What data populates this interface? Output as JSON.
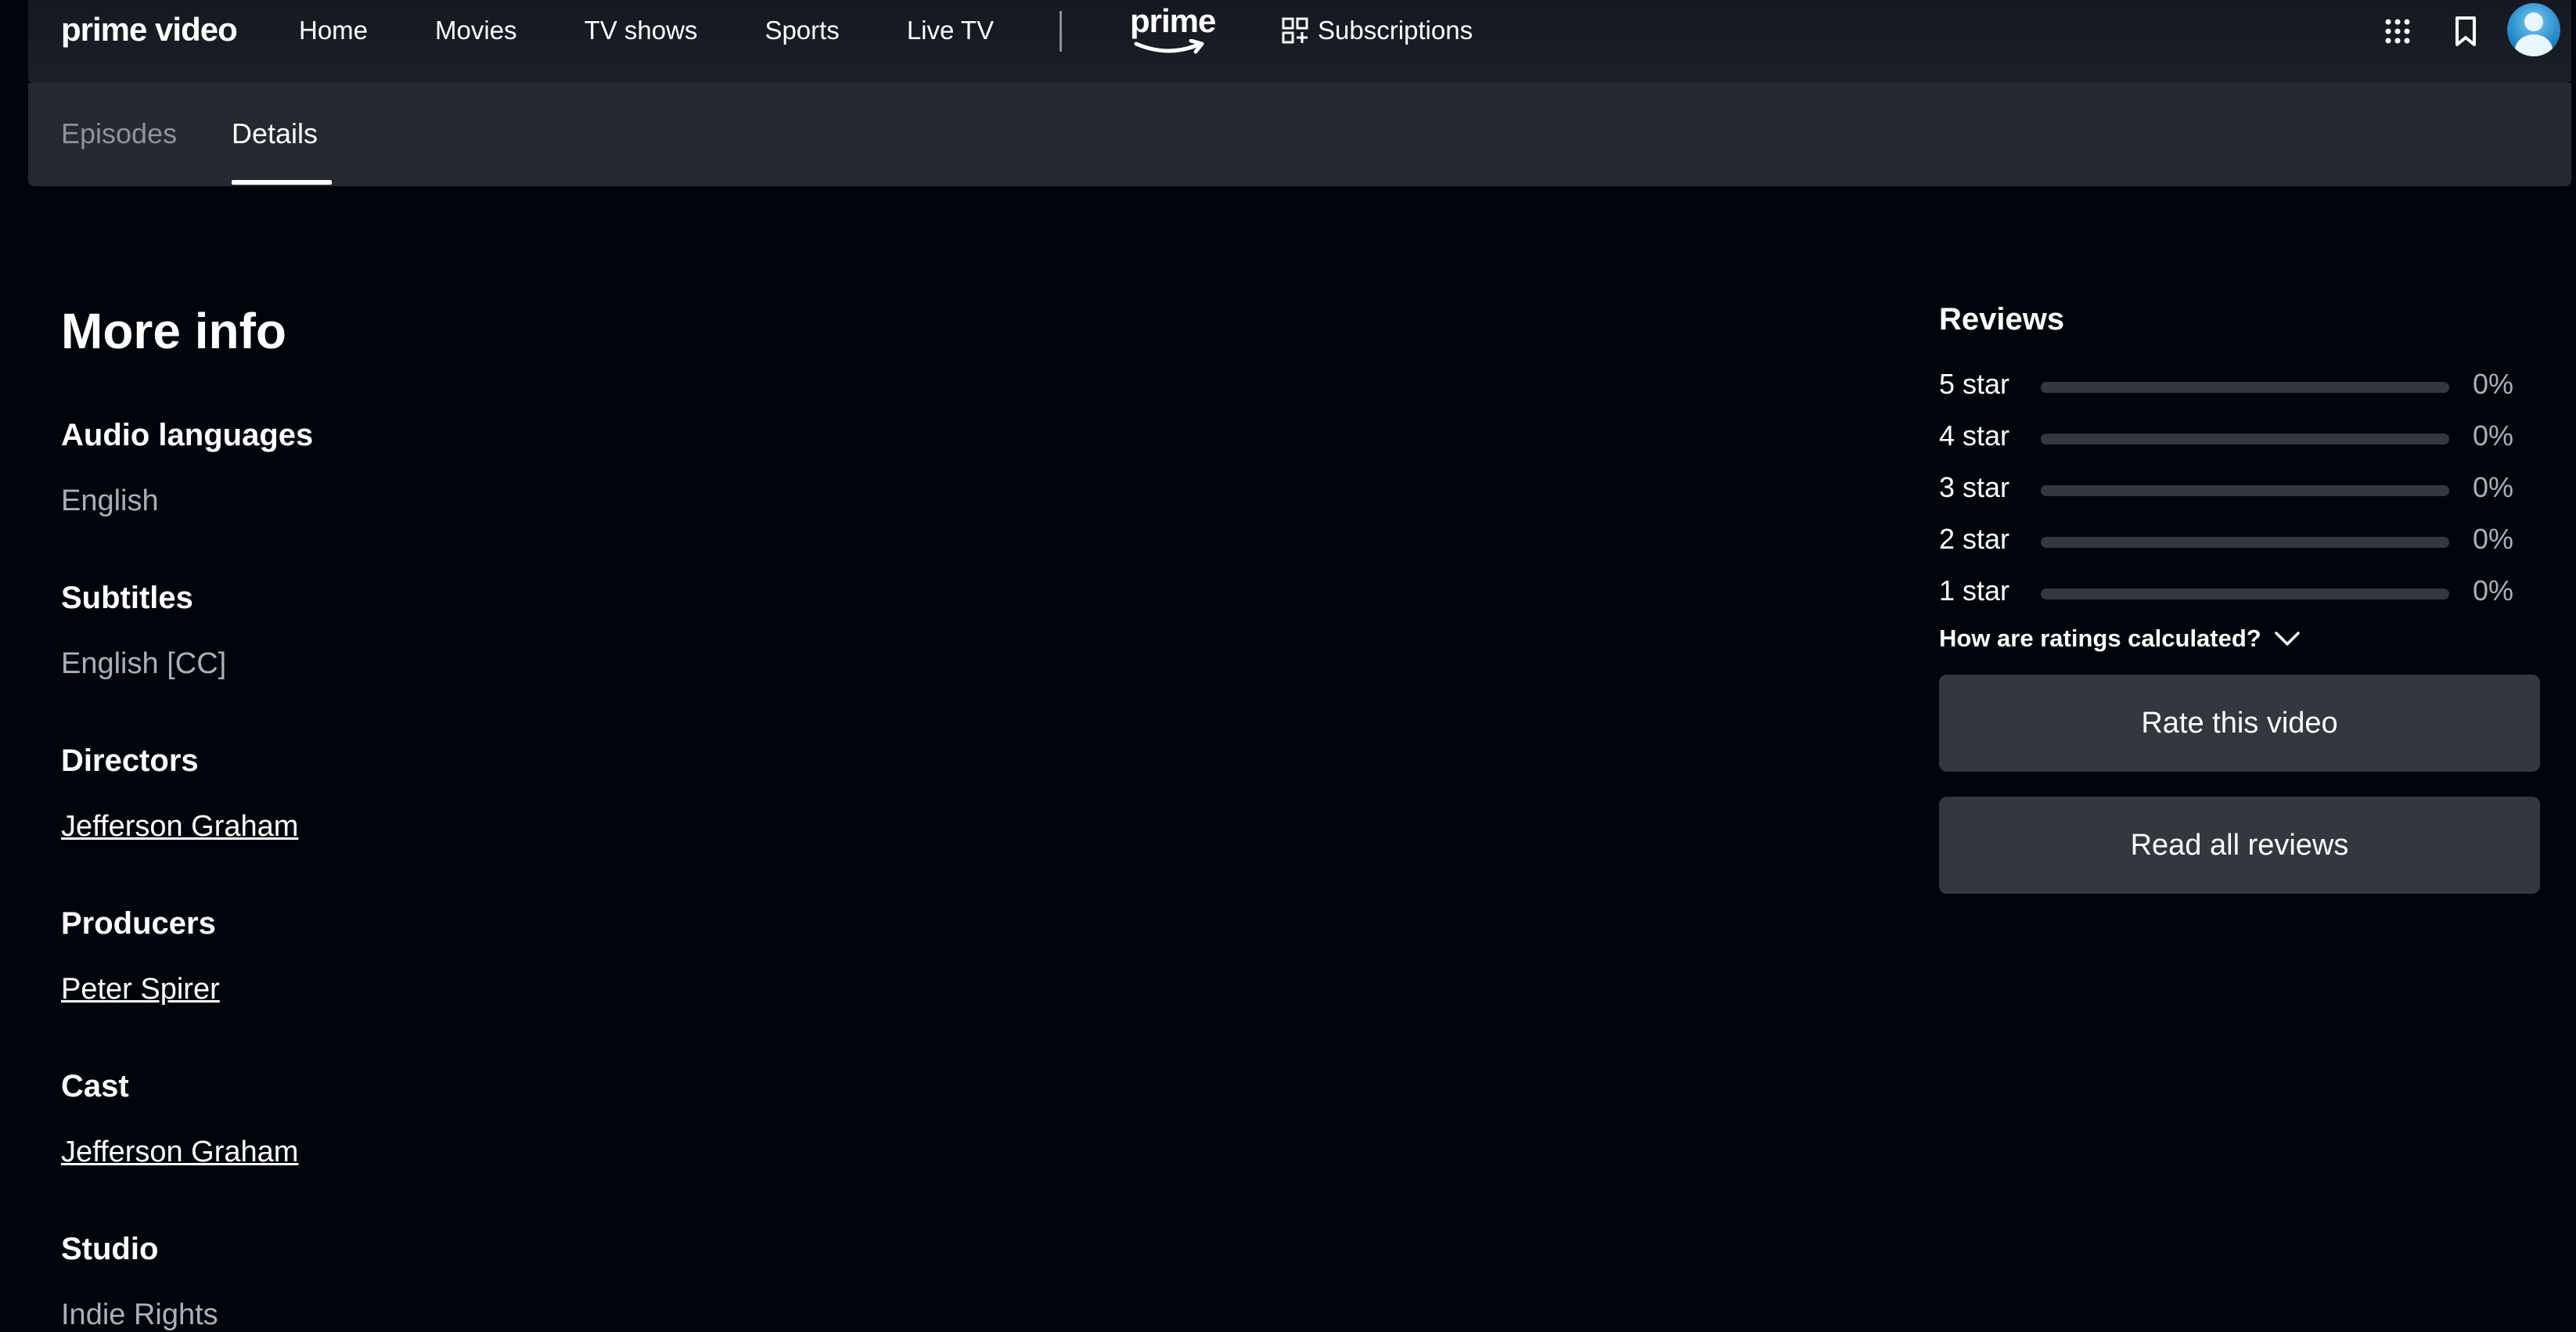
{
  "header": {
    "logo": "prime video",
    "nav": [
      "Home",
      "Movies",
      "TV shows",
      "Sports",
      "Live TV"
    ],
    "prime_badge": "prime",
    "subscriptions": "Subscriptions",
    "icons": [
      "apps-grid-icon",
      "watchlist-bookmark-icon",
      "profile-avatar"
    ]
  },
  "tabs": [
    "Episodes",
    "Details"
  ],
  "active_tab": "Details",
  "more_info": {
    "title": "More info",
    "audio_label": "Audio languages",
    "audio_value": "English",
    "subtitles_label": "Subtitles",
    "subtitles_value": "English [CC]",
    "directors_label": "Directors",
    "directors_value": "Jefferson Graham",
    "producers_label": "Producers",
    "producers_value": "Peter Spirer",
    "cast_label": "Cast",
    "cast_value": "Jefferson Graham",
    "studio_label": "Studio",
    "studio_value": "Indie Rights"
  },
  "reviews": {
    "title": "Reviews",
    "rows": [
      {
        "label": "5 star",
        "percent": "0%",
        "fraction": 0
      },
      {
        "label": "4 star",
        "percent": "0%",
        "fraction": 0
      },
      {
        "label": "3 star",
        "percent": "0%",
        "fraction": 0
      },
      {
        "label": "2 star",
        "percent": "0%",
        "fraction": 0
      },
      {
        "label": "1 star",
        "percent": "0%",
        "fraction": 0
      }
    ],
    "how_calculated": "How are ratings calculated?",
    "rate_button": "Rate this video",
    "read_button": "Read all reviews"
  }
}
